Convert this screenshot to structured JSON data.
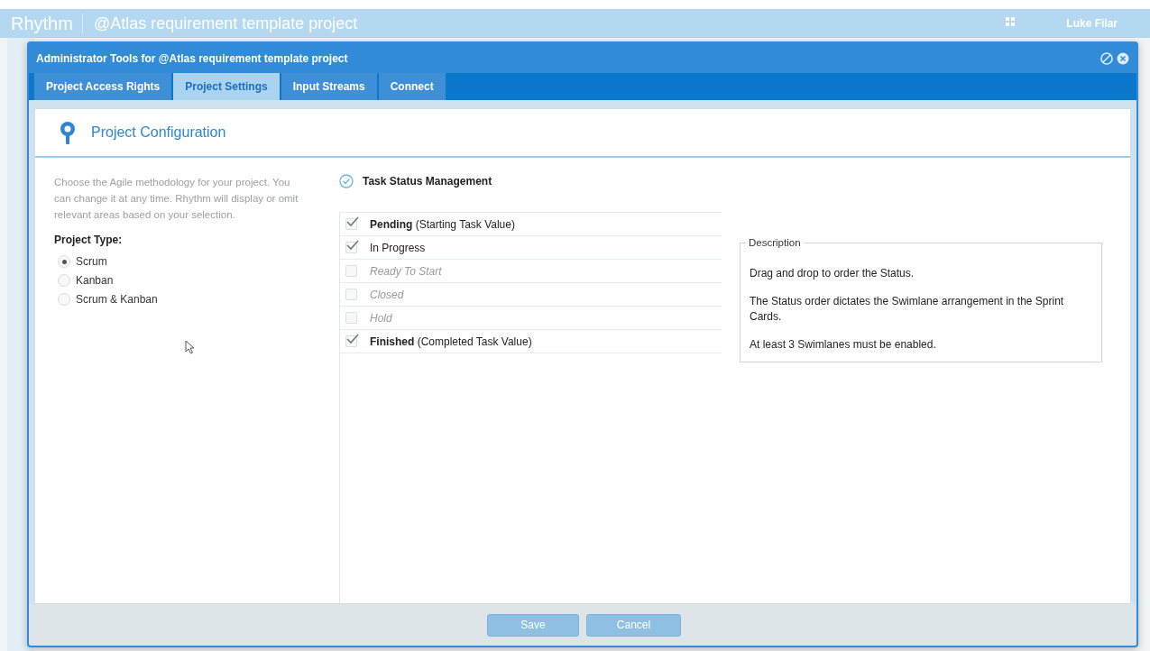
{
  "app_header": {
    "brand": "Rhythm",
    "project_title": "@Atlas requirement template project",
    "user": "Luke Filar"
  },
  "dialog": {
    "title": "Administrator Tools for @Atlas requirement template project",
    "tabs": [
      {
        "label": "Project Access Rights",
        "selected": false
      },
      {
        "label": "Project Settings",
        "selected": true
      },
      {
        "label": "Input Streams",
        "selected": false
      },
      {
        "label": "Connect",
        "selected": false
      }
    ],
    "section_title": "Project Configuration",
    "intro": "Choose the Agile methodology for your project. You can change it at any time. Rhythm will display or omit relevant areas based on your selection.",
    "project_type": {
      "label": "Project Type:",
      "options": [
        {
          "label": "Scrum",
          "selected": true
        },
        {
          "label": "Kanban",
          "selected": false
        },
        {
          "label": "Scrum & Kanban",
          "selected": false
        }
      ]
    },
    "task_status": {
      "title": "Task Status Management",
      "items": [
        {
          "label": "**Pending** (Starting Task Value)",
          "checked": true
        },
        {
          "label": "In Progress",
          "checked": true
        },
        {
          "label": "Ready To Start",
          "checked": false
        },
        {
          "label": "Closed",
          "checked": false
        },
        {
          "label": "Hold",
          "checked": false
        },
        {
          "label": "**Finished** (Completed Task Value)",
          "checked": true
        }
      ]
    },
    "description": {
      "legend": "Description",
      "paragraphs": [
        "Drag and drop to order the Status.",
        "The Status order dictates the Swimlane arrangement in the Sprint Cards.",
        "At least 3 Swimlanes must be enabled."
      ]
    },
    "buttons": [
      {
        "label": "Save",
        "disabled": true
      },
      {
        "label": "Cancel",
        "disabled": true
      }
    ]
  }
}
